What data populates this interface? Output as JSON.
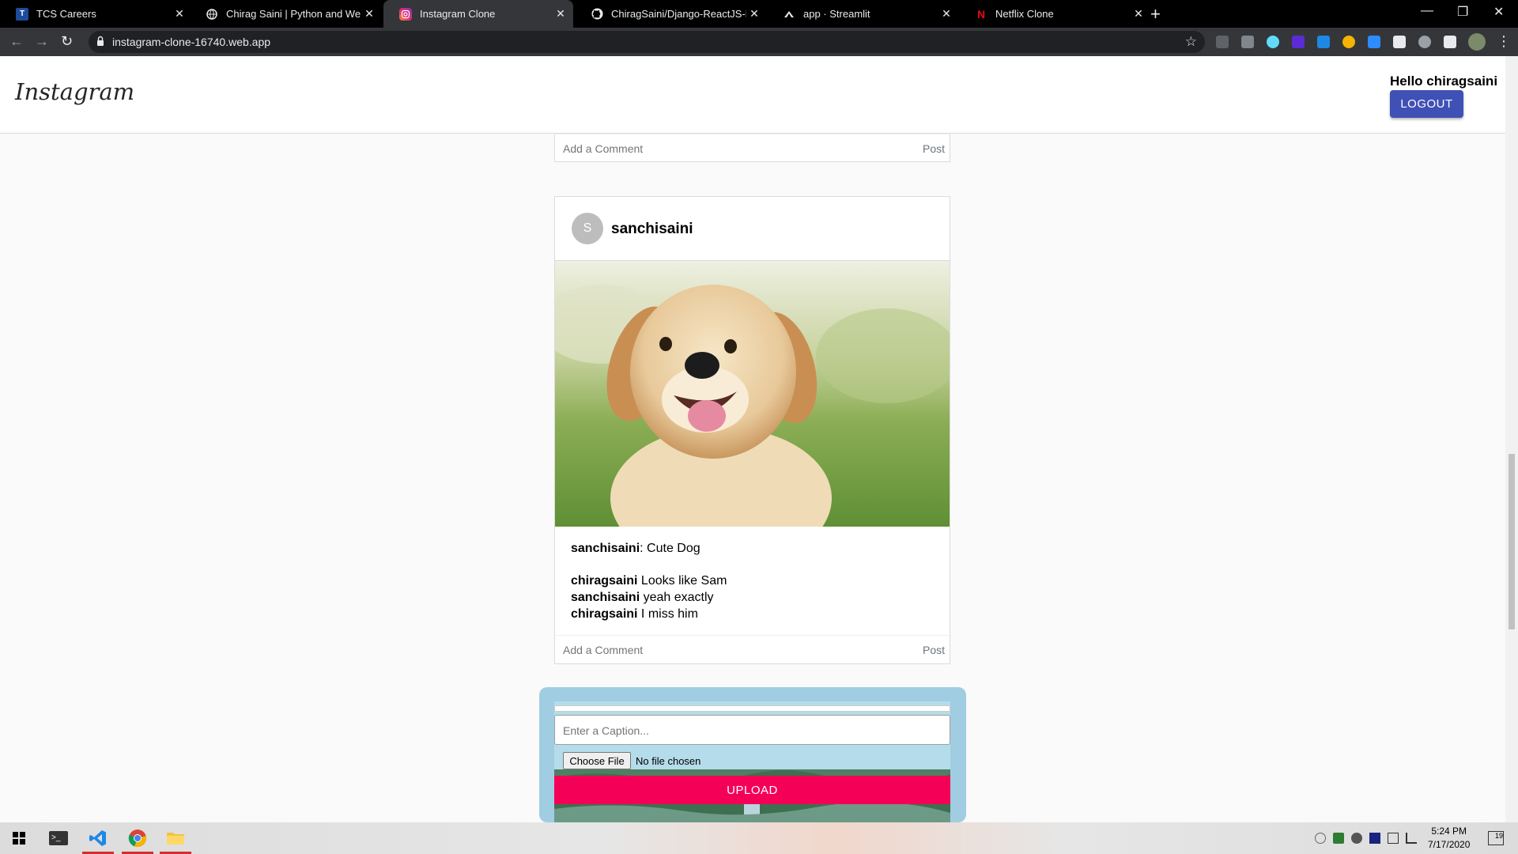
{
  "browser": {
    "tabs": [
      {
        "title": "TCS Careers",
        "icon": "tcs-icon",
        "active": false
      },
      {
        "title": "Chirag Saini | Python and Web D",
        "icon": "globe-icon",
        "active": false
      },
      {
        "title": "Instagram Clone",
        "icon": "instagram-icon",
        "active": true
      },
      {
        "title": "ChiragSaini/Django-ReactJS-Real",
        "icon": "github-icon",
        "active": false
      },
      {
        "title": "app · Streamlit",
        "icon": "streamlit-icon",
        "active": false
      },
      {
        "title": "Netflix Clone",
        "icon": "netflix-icon",
        "active": false
      }
    ],
    "url": "instagram-clone-16740.web.app"
  },
  "header": {
    "logo": "Instagram",
    "greeting": "Hello chiragsaini",
    "logout_label": "LOGOUT"
  },
  "top_comment_box": {
    "placeholder": "Add a Comment",
    "post_label": "Post"
  },
  "post": {
    "avatar_letter": "S",
    "username": "sanchisaini",
    "image_alt": "golden-retriever-photo",
    "caption_user": "sanchisaini",
    "caption_text": ": Cute Dog",
    "comments": [
      {
        "user": "chiragsaini",
        "text": " Looks like Sam"
      },
      {
        "user": "sanchisaini",
        "text": " yeah exactly"
      },
      {
        "user": "chiragsaini",
        "text": " I miss him"
      }
    ],
    "comment_placeholder": "Add a Comment",
    "post_label": "Post"
  },
  "upload": {
    "caption_placeholder": "Enter a Caption...",
    "choose_file_label": "Choose File",
    "file_status": "No file chosen",
    "upload_label": "UPLOAD"
  },
  "taskbar": {
    "time": "5:24 PM",
    "date": "7/17/2020",
    "notification_count": "19"
  },
  "colors": {
    "logout_bg": "#3f51b5",
    "upload_bg": "#f50057",
    "upload_card_bg": "#a1cde3"
  }
}
